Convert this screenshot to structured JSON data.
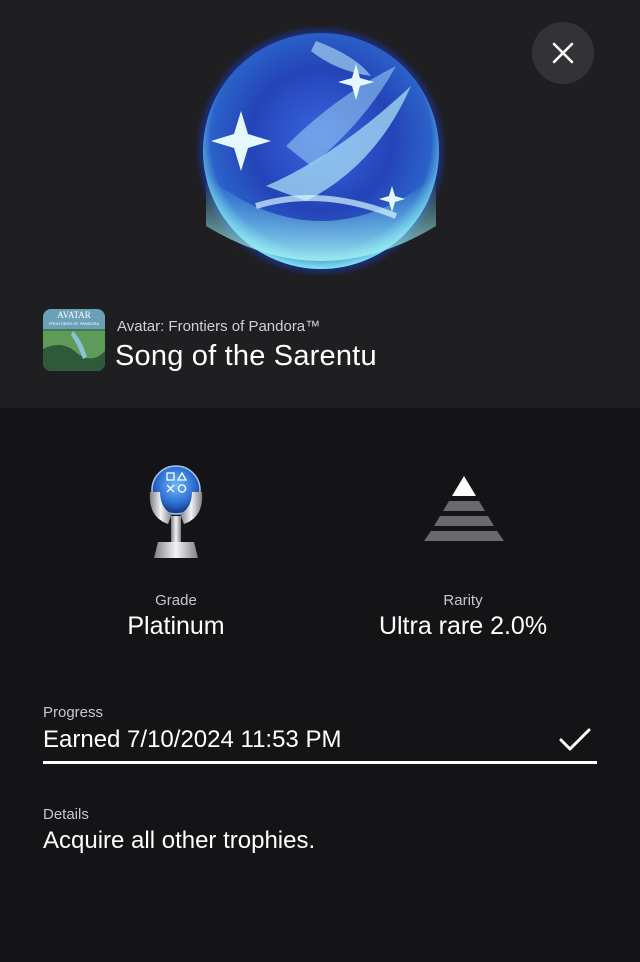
{
  "header": {
    "game_title": "Avatar: Frontiers of Pandora™",
    "trophy_name": "Song of the Sarentu",
    "game_icon_text_line1": "AVATAR",
    "game_icon_text_line2": "FRONTIERS OF PANDORA"
  },
  "close_icon": "close-icon",
  "stats": {
    "grade_label": "Grade",
    "grade_value": "Platinum",
    "rarity_label": "Rarity",
    "rarity_value": "Ultra rare 2.0%"
  },
  "progress": {
    "label": "Progress",
    "value": "Earned 7/10/2024  11:53 PM",
    "status_icon": "check-icon"
  },
  "details": {
    "label": "Details",
    "value": "Acquire all other trophies."
  },
  "colors": {
    "background": "#141416",
    "header_bg": "#1f1f22",
    "close_button_bg": "#333336",
    "trophy_blue": "#2d4fc4",
    "trophy_cyan": "#8ef0f0"
  }
}
